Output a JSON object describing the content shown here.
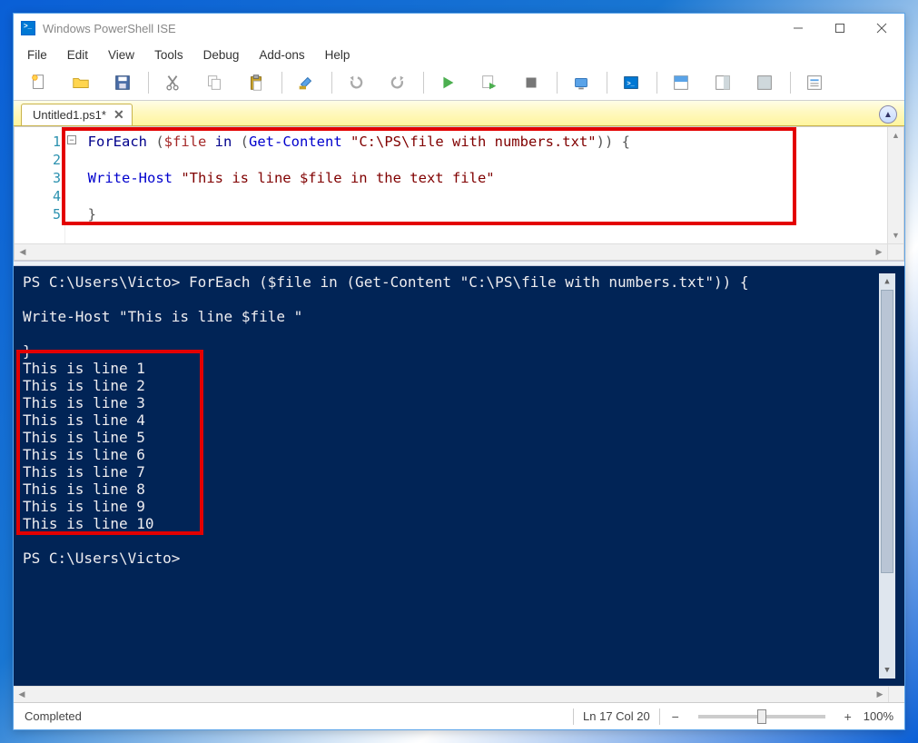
{
  "title": "Windows PowerShell ISE",
  "menu": [
    "File",
    "Edit",
    "View",
    "Tools",
    "Debug",
    "Add-ons",
    "Help"
  ],
  "toolbar_icons": [
    "new-file-icon",
    "open-file-icon",
    "save-icon",
    "sep",
    "cut-icon",
    "copy-icon",
    "paste-icon",
    "sep",
    "clear-icon",
    "sep",
    "undo-icon",
    "redo-icon",
    "sep",
    "run-icon",
    "run-selection-icon",
    "stop-icon",
    "sep",
    "new-remote-tab-icon",
    "sep",
    "powershell-icon",
    "sep",
    "show-script-pane-top-icon",
    "show-script-pane-right-icon",
    "show-script-pane-max-icon",
    "sep",
    "show-command-icon"
  ],
  "tab": {
    "name": "Untitled1.ps1*"
  },
  "gutter": [
    "1",
    "2",
    "3",
    "4",
    "5"
  ],
  "code": {
    "line1_pre": "ForEach ",
    "line1_paren1": "(",
    "line1_var": "$file",
    "line1_in": " in ",
    "line1_paren2": "(",
    "line1_cmd": "Get-Content ",
    "line1_str": "\"C:\\PS\\file with numbers.txt\"",
    "line1_post": ")) {",
    "line3_cmd": "Write-Host ",
    "line3_str": "\"This is line $file in the text file\"",
    "line5": "}"
  },
  "console": {
    "prompt1": "PS C:\\Users\\Victo> ",
    "cmd1": "ForEach ($file in (Get-Content \"C:\\PS\\file with numbers.txt\")) {",
    "cmd2": "Write-Host \"This is line $file \"",
    "cmd3": "}",
    "out": [
      "This is line 1",
      "This is line 2",
      "This is line 3",
      "This is line 4",
      "This is line 5",
      "This is line 6",
      "This is line 7",
      "This is line 8",
      "This is line 9",
      "This is line 10"
    ],
    "prompt2": "PS C:\\Users\\Victo> "
  },
  "status": {
    "text": "Completed",
    "pos": "Ln 17  Col 20",
    "zoom": "100%"
  }
}
